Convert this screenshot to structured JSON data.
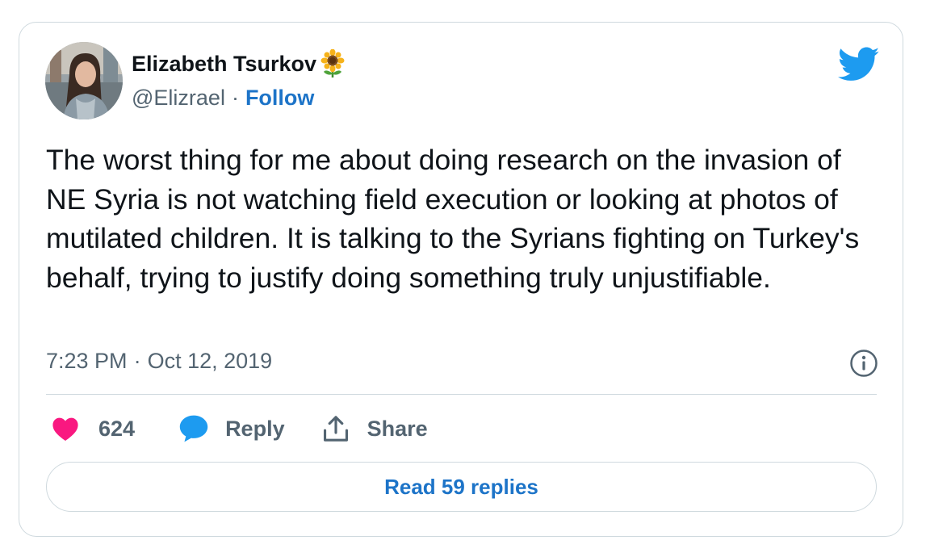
{
  "author": {
    "display_name": "Elizabeth Tsurkov",
    "handle": "@Elizrael",
    "separator": "·",
    "follow_label": "Follow",
    "name_emoji": "sunflower-icon",
    "avatar": "avatar-photo"
  },
  "brand_icon": "twitter-bird-icon",
  "tweet": {
    "text": "The worst thing for me about doing research on the invasion of NE Syria is not watching field execution or looking at photos of mutilated children. It is talking to the Syrians fighting on Turkey's behalf, trying to justify doing something truly unjustifiable.",
    "time": "7:23 PM",
    "separator": "·",
    "date": "Oct 12, 2019",
    "info_icon": "info-icon"
  },
  "actions": {
    "like_count": "624",
    "like_icon": "heart-icon",
    "reply_label": "Reply",
    "reply_icon": "speech-bubble-icon",
    "share_label": "Share",
    "share_icon": "share-upload-icon"
  },
  "read_replies_label": "Read 59 replies",
  "colors": {
    "accent_blue": "#1d74c8",
    "twitter_blue": "#1d9bf0",
    "heart_pink": "#f91880",
    "text_primary": "#0f1419",
    "text_secondary": "#536471",
    "border": "#cfd9de"
  }
}
